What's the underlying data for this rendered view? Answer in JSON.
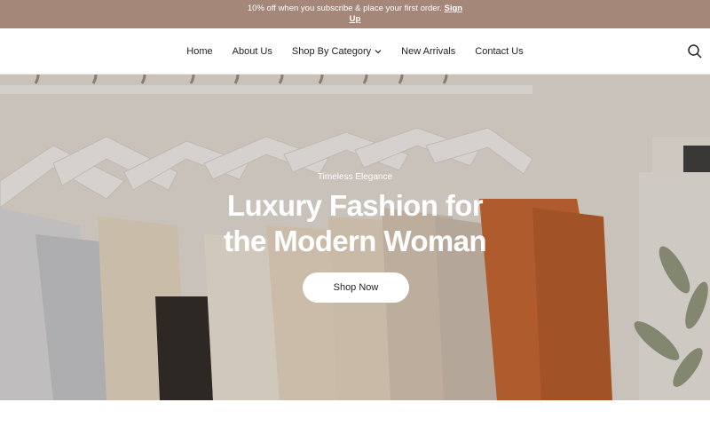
{
  "announcement": {
    "text": "10% off when you subscribe & place your first order.",
    "link_line1": "Sign",
    "link_line2": "Up"
  },
  "nav": {
    "items": [
      {
        "label": "Home"
      },
      {
        "label": "About Us"
      },
      {
        "label": "Shop By Category"
      },
      {
        "label": "New Arrivals"
      },
      {
        "label": "Contact Us"
      }
    ]
  },
  "hero": {
    "eyebrow": "Timeless Elegance",
    "headline_line1": "Luxury Fashion for",
    "headline_line2": "the Modern Woman",
    "cta_label": "Shop Now"
  },
  "colors": {
    "announcement_bg": "#a5877a",
    "text": "#222222"
  },
  "icons": [
    "chevron-down-icon",
    "search-icon"
  ]
}
